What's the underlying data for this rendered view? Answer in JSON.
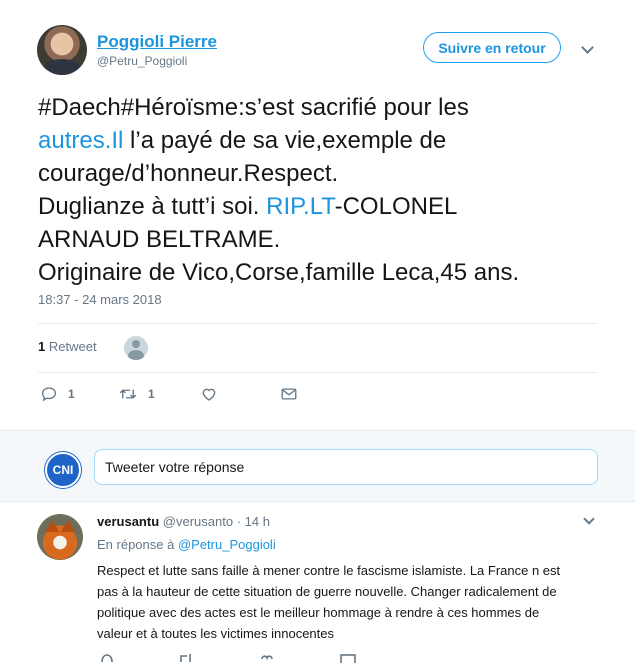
{
  "tweet": {
    "author_name": "Poggioli Pierre",
    "author_handle": "@Petru_Poggioli",
    "follow_label": "Suivre en retour",
    "text_lines": [
      [
        {
          "t": "#Daech#Héroïsme:s’est sacrifié pour les",
          "link": false
        }
      ],
      [
        {
          "t": "autres.Il",
          "link": true
        },
        {
          "t": " l’a payé de sa vie,exemple de",
          "link": false
        }
      ],
      [
        {
          "t": "courage/d’honneur.Respect.",
          "link": false
        }
      ],
      [
        {
          "t": "Duglianze à tutt’i soi. ",
          "link": false
        },
        {
          "t": "RIP.LT",
          "link": true
        },
        {
          "t": "-COLONEL",
          "link": false
        }
      ],
      [
        {
          "t": "ARNAUD BELTRAME.",
          "link": false
        }
      ],
      [
        {
          "t": "Originaire de Vico,Corse,famille Leca,45 ans.",
          "link": false
        }
      ]
    ],
    "timestamp": "18:37 - 24 mars 2018",
    "retweet_count": "1",
    "retweet_label": "Retweet",
    "actions": {
      "reply_count": "1",
      "retweet_count": "1"
    }
  },
  "reply_box": {
    "logo_text": "CNI",
    "placeholder": "Tweeter votre réponse"
  },
  "reply": {
    "author_name": "verusantu",
    "author_handle": "@verusanto",
    "separator": "·",
    "time": "14 h",
    "in_reply_prefix": "En réponse à ",
    "in_reply_handle": "@Petru_Poggioli",
    "text_lines": [
      "Respect et lutte sans faille à mener contre le fascisme islamiste. La France n est",
      "pas à la hauteur de cette situation de guerre nouvelle. Changer radicalement de",
      "politique avec des actes est le meilleur hommage à rendre à ces hommes de",
      "valeur et à toutes les victimes innocentes"
    ]
  },
  "colors": {
    "link": "#1b95e0",
    "text": "#14171a",
    "muted": "#657786",
    "divider": "#e6ecf0"
  }
}
